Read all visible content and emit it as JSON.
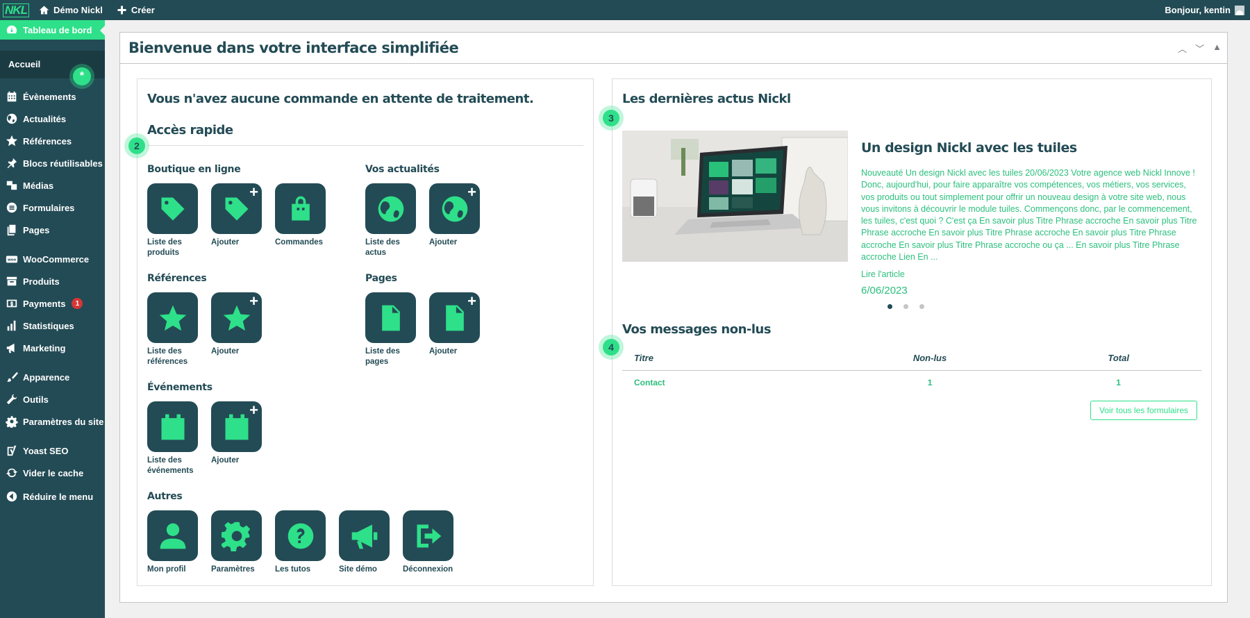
{
  "adminbar": {
    "logo": "NKL",
    "site_name": "Démo Nickl",
    "create": "Créer",
    "greeting": "Bonjour, kentin"
  },
  "sidebar": {
    "items": [
      {
        "label": "Tableau de bord",
        "icon": "dashboard-icon"
      },
      {
        "label": "Accueil"
      },
      {
        "label": "Évènements",
        "icon": "calendar-icon"
      },
      {
        "label": "Actualités",
        "icon": "globe-icon"
      },
      {
        "label": "Références",
        "icon": "star-icon"
      },
      {
        "label": "Blocs réutilisables",
        "icon": "pin-icon"
      },
      {
        "label": "Médias",
        "icon": "media-icon"
      },
      {
        "label": "Formulaires",
        "icon": "forms-icon"
      },
      {
        "label": "Pages",
        "icon": "pages-icon"
      },
      {
        "label": "WooCommerce",
        "icon": "woo-icon"
      },
      {
        "label": "Produits",
        "icon": "archive-icon"
      },
      {
        "label": "Payments",
        "icon": "dollar-icon",
        "badge": "1"
      },
      {
        "label": "Statistiques",
        "icon": "chart-icon"
      },
      {
        "label": "Marketing",
        "icon": "megaphone-icon"
      },
      {
        "label": "Apparence",
        "icon": "brush-icon"
      },
      {
        "label": "Outils",
        "icon": "wrench-icon"
      },
      {
        "label": "Paramètres du site",
        "icon": "gear-icon"
      },
      {
        "label": "Yoast SEO",
        "icon": "yoast-icon"
      },
      {
        "label": "Vider le cache",
        "icon": "refresh-icon"
      },
      {
        "label": "Réduire le menu",
        "icon": "collapse-icon"
      }
    ]
  },
  "main": {
    "title": "Bienvenue dans votre interface simplifiée",
    "left": {
      "no_orders": "Vous n'avez aucune commande en attente de traitement.",
      "quick_access": "Accès rapide",
      "groups": {
        "boutique": "Boutique en ligne",
        "actus": "Vos actualités",
        "references": "Références",
        "pages": "Pages",
        "evenements": "Événements",
        "autres": "Autres"
      },
      "tiles": {
        "products_list": "Liste des produits",
        "products_add": "Ajouter",
        "orders": "Commandes",
        "news_list": "Liste des actus",
        "news_add": "Ajouter",
        "refs_list": "Liste des références",
        "refs_add": "Ajouter",
        "pages_list": "Liste des pages",
        "pages_add": "Ajouter",
        "events_list": "Liste des événements",
        "events_add": "Ajouter",
        "profile": "Mon profil",
        "settings": "Paramètres",
        "tutos": "Les tutos",
        "demo": "Site démo",
        "logout": "Déconnexion"
      }
    },
    "right": {
      "news_heading": "Les dernières actus Nickl",
      "news": {
        "title": "Un design Nickl avec les tuiles",
        "excerpt": "Nouveauté Un design Nickl avec les tuiles 20/06/2023 Votre agence web Nickl Innove !  Donc, aujourd'hui, pour faire apparaître vos compétences, vos métiers, vos services, vos produits ou tout simplement pour offrir un nouveau design à votre site web, nous vous invitons à découvrir le module tuiles. Commençons donc, par le commencement, les tuiles, c'est quoi ? C'est ça En savoir plus Titre Phrase accroche En savoir plus Titre Phrase accroche En savoir plus Titre Phrase accroche En savoir plus Titre Phrase accroche En savoir plus Titre Phrase accroche ou ça ... En savoir plus Titre Phrase accroche Lien En ...",
        "read_more": "Lire l'article",
        "date": "6/06/2023"
      },
      "messages_heading": "Vos messages non-lus",
      "table": {
        "headers": [
          "Titre",
          "Non-lus",
          "Total"
        ],
        "rows": [
          [
            "Contact",
            "1",
            "1"
          ]
        ]
      },
      "all_forms_button": "Voir tous les formulaires"
    },
    "steps": [
      "2",
      "3",
      "4"
    ]
  },
  "colors": {
    "primary": "#234b55",
    "accent": "#2ee089",
    "link": "#2bbf7d",
    "badge": "#d63638"
  }
}
